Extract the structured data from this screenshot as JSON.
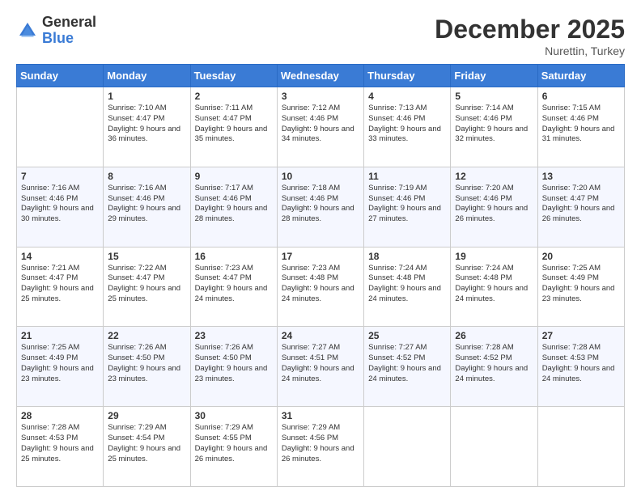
{
  "header": {
    "logo_general": "General",
    "logo_blue": "Blue",
    "month_title": "December 2025",
    "subtitle": "Nurettin, Turkey"
  },
  "weekdays": [
    "Sunday",
    "Monday",
    "Tuesday",
    "Wednesday",
    "Thursday",
    "Friday",
    "Saturday"
  ],
  "weeks": [
    [
      {
        "day": "",
        "sunrise": "",
        "sunset": "",
        "daylight": ""
      },
      {
        "day": "1",
        "sunrise": "Sunrise: 7:10 AM",
        "sunset": "Sunset: 4:47 PM",
        "daylight": "Daylight: 9 hours and 36 minutes."
      },
      {
        "day": "2",
        "sunrise": "Sunrise: 7:11 AM",
        "sunset": "Sunset: 4:47 PM",
        "daylight": "Daylight: 9 hours and 35 minutes."
      },
      {
        "day": "3",
        "sunrise": "Sunrise: 7:12 AM",
        "sunset": "Sunset: 4:46 PM",
        "daylight": "Daylight: 9 hours and 34 minutes."
      },
      {
        "day": "4",
        "sunrise": "Sunrise: 7:13 AM",
        "sunset": "Sunset: 4:46 PM",
        "daylight": "Daylight: 9 hours and 33 minutes."
      },
      {
        "day": "5",
        "sunrise": "Sunrise: 7:14 AM",
        "sunset": "Sunset: 4:46 PM",
        "daylight": "Daylight: 9 hours and 32 minutes."
      },
      {
        "day": "6",
        "sunrise": "Sunrise: 7:15 AM",
        "sunset": "Sunset: 4:46 PM",
        "daylight": "Daylight: 9 hours and 31 minutes."
      }
    ],
    [
      {
        "day": "7",
        "sunrise": "Sunrise: 7:16 AM",
        "sunset": "Sunset: 4:46 PM",
        "daylight": "Daylight: 9 hours and 30 minutes."
      },
      {
        "day": "8",
        "sunrise": "Sunrise: 7:16 AM",
        "sunset": "Sunset: 4:46 PM",
        "daylight": "Daylight: 9 hours and 29 minutes."
      },
      {
        "day": "9",
        "sunrise": "Sunrise: 7:17 AM",
        "sunset": "Sunset: 4:46 PM",
        "daylight": "Daylight: 9 hours and 28 minutes."
      },
      {
        "day": "10",
        "sunrise": "Sunrise: 7:18 AM",
        "sunset": "Sunset: 4:46 PM",
        "daylight": "Daylight: 9 hours and 28 minutes."
      },
      {
        "day": "11",
        "sunrise": "Sunrise: 7:19 AM",
        "sunset": "Sunset: 4:46 PM",
        "daylight": "Daylight: 9 hours and 27 minutes."
      },
      {
        "day": "12",
        "sunrise": "Sunrise: 7:20 AM",
        "sunset": "Sunset: 4:46 PM",
        "daylight": "Daylight: 9 hours and 26 minutes."
      },
      {
        "day": "13",
        "sunrise": "Sunrise: 7:20 AM",
        "sunset": "Sunset: 4:47 PM",
        "daylight": "Daylight: 9 hours and 26 minutes."
      }
    ],
    [
      {
        "day": "14",
        "sunrise": "Sunrise: 7:21 AM",
        "sunset": "Sunset: 4:47 PM",
        "daylight": "Daylight: 9 hours and 25 minutes."
      },
      {
        "day": "15",
        "sunrise": "Sunrise: 7:22 AM",
        "sunset": "Sunset: 4:47 PM",
        "daylight": "Daylight: 9 hours and 25 minutes."
      },
      {
        "day": "16",
        "sunrise": "Sunrise: 7:23 AM",
        "sunset": "Sunset: 4:47 PM",
        "daylight": "Daylight: 9 hours and 24 minutes."
      },
      {
        "day": "17",
        "sunrise": "Sunrise: 7:23 AM",
        "sunset": "Sunset: 4:48 PM",
        "daylight": "Daylight: 9 hours and 24 minutes."
      },
      {
        "day": "18",
        "sunrise": "Sunrise: 7:24 AM",
        "sunset": "Sunset: 4:48 PM",
        "daylight": "Daylight: 9 hours and 24 minutes."
      },
      {
        "day": "19",
        "sunrise": "Sunrise: 7:24 AM",
        "sunset": "Sunset: 4:48 PM",
        "daylight": "Daylight: 9 hours and 24 minutes."
      },
      {
        "day": "20",
        "sunrise": "Sunrise: 7:25 AM",
        "sunset": "Sunset: 4:49 PM",
        "daylight": "Daylight: 9 hours and 23 minutes."
      }
    ],
    [
      {
        "day": "21",
        "sunrise": "Sunrise: 7:25 AM",
        "sunset": "Sunset: 4:49 PM",
        "daylight": "Daylight: 9 hours and 23 minutes."
      },
      {
        "day": "22",
        "sunrise": "Sunrise: 7:26 AM",
        "sunset": "Sunset: 4:50 PM",
        "daylight": "Daylight: 9 hours and 23 minutes."
      },
      {
        "day": "23",
        "sunrise": "Sunrise: 7:26 AM",
        "sunset": "Sunset: 4:50 PM",
        "daylight": "Daylight: 9 hours and 23 minutes."
      },
      {
        "day": "24",
        "sunrise": "Sunrise: 7:27 AM",
        "sunset": "Sunset: 4:51 PM",
        "daylight": "Daylight: 9 hours and 24 minutes."
      },
      {
        "day": "25",
        "sunrise": "Sunrise: 7:27 AM",
        "sunset": "Sunset: 4:52 PM",
        "daylight": "Daylight: 9 hours and 24 minutes."
      },
      {
        "day": "26",
        "sunrise": "Sunrise: 7:28 AM",
        "sunset": "Sunset: 4:52 PM",
        "daylight": "Daylight: 9 hours and 24 minutes."
      },
      {
        "day": "27",
        "sunrise": "Sunrise: 7:28 AM",
        "sunset": "Sunset: 4:53 PM",
        "daylight": "Daylight: 9 hours and 24 minutes."
      }
    ],
    [
      {
        "day": "28",
        "sunrise": "Sunrise: 7:28 AM",
        "sunset": "Sunset: 4:53 PM",
        "daylight": "Daylight: 9 hours and 25 minutes."
      },
      {
        "day": "29",
        "sunrise": "Sunrise: 7:29 AM",
        "sunset": "Sunset: 4:54 PM",
        "daylight": "Daylight: 9 hours and 25 minutes."
      },
      {
        "day": "30",
        "sunrise": "Sunrise: 7:29 AM",
        "sunset": "Sunset: 4:55 PM",
        "daylight": "Daylight: 9 hours and 26 minutes."
      },
      {
        "day": "31",
        "sunrise": "Sunrise: 7:29 AM",
        "sunset": "Sunset: 4:56 PM",
        "daylight": "Daylight: 9 hours and 26 minutes."
      },
      {
        "day": "",
        "sunrise": "",
        "sunset": "",
        "daylight": ""
      },
      {
        "day": "",
        "sunrise": "",
        "sunset": "",
        "daylight": ""
      },
      {
        "day": "",
        "sunrise": "",
        "sunset": "",
        "daylight": ""
      }
    ]
  ]
}
